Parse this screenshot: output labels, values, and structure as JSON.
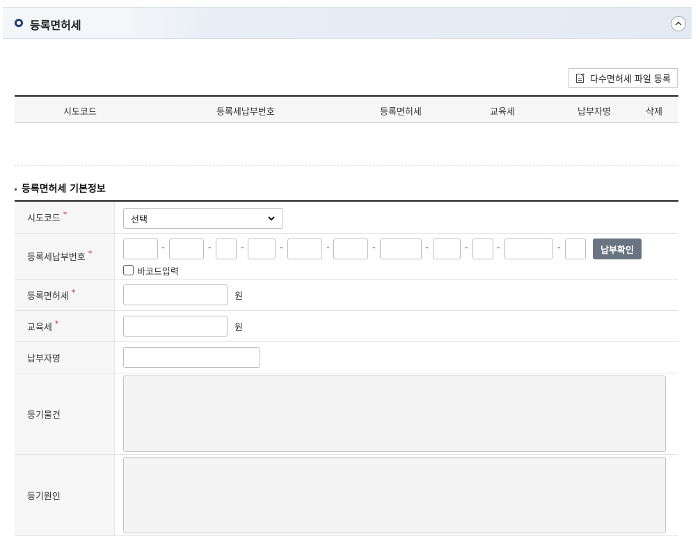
{
  "header": {
    "title": "등록면허세"
  },
  "toolbar": {
    "multi_file_label": "다수면허세 파일 등록"
  },
  "list_table": {
    "columns": [
      "시도코드",
      "등록세납부번호",
      "등록면허세",
      "교육세",
      "납부자명",
      "삭제"
    ]
  },
  "section": {
    "title": "등록면허세 기본정보"
  },
  "form": {
    "sido_label": "시도코드",
    "sido_value": "선택",
    "payno_label": "등록세납부번호",
    "confirm_label": "납부확인",
    "barcode_label": "바코드입력",
    "tax_label": "등록면허세",
    "edu_label": "교육세",
    "payer_label": "납부자명",
    "object_label": "등기물건",
    "cause_label": "등기원인",
    "unit": "원",
    "required_mark": "*",
    "dash": "-"
  },
  "colors": {
    "accent": "#1d3f72",
    "button": "#6a7382",
    "required": "#dd2222"
  }
}
